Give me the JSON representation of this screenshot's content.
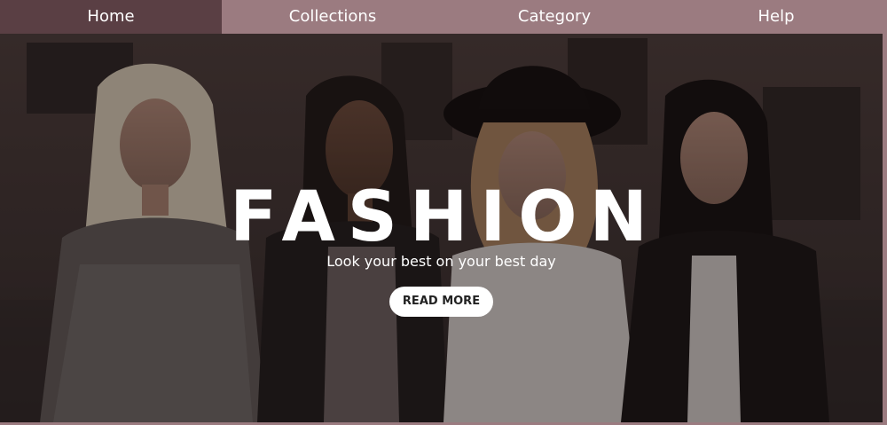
{
  "nav": {
    "items": [
      {
        "label": "Home",
        "active": true
      },
      {
        "label": "Collections",
        "active": false
      },
      {
        "label": "Category",
        "active": false
      },
      {
        "label": "Help",
        "active": false
      }
    ]
  },
  "hero": {
    "title": "FASHION",
    "subtitle": "Look your best on your best day",
    "button_label": "READ MORE"
  },
  "colors": {
    "nav_background": "#9b7b80",
    "nav_active": "#5a3f44",
    "button_background": "#ffffff",
    "text": "#ffffff"
  }
}
